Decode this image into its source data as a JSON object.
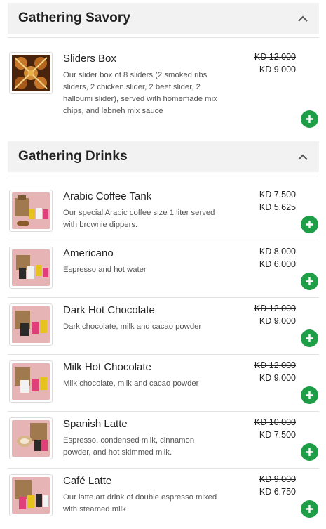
{
  "sections": [
    {
      "title": "Gathering Savory",
      "items": [
        {
          "name": "Sliders Box",
          "description": "Our slider box of 8 sliders (2 smoked ribs sliders, 2 chicken slider, 2 beef slider, 2 halloumi slider), served with homemade mix chips, and labneh mix sauce",
          "old_price": "KD 12.000",
          "price": "KD 9.000"
        }
      ]
    },
    {
      "title": "Gathering Drinks",
      "items": [
        {
          "name": "Arabic Coffee Tank",
          "description": "Our special Arabic coffee size 1 liter served with brownie dippers.",
          "old_price": "KD 7.500",
          "price": "KD 5.625"
        },
        {
          "name": "Americano",
          "description": "Espresso and hot water",
          "old_price": "KD 8.000",
          "price": "KD 6.000"
        },
        {
          "name": "Dark Hot Chocolate",
          "description": "Dark chocolate, milk and cacao powder",
          "old_price": "KD 12.000",
          "price": "KD 9.000"
        },
        {
          "name": "Milk Hot Chocolate",
          "description": "Milk chocolate, milk and cacao powder",
          "old_price": "KD 12.000",
          "price": "KD 9.000"
        },
        {
          "name": "Spanish Latte",
          "description": "Espresso, condensed milk, cinnamon powder, and hot skimmed milk.",
          "old_price": "KD 10.000",
          "price": "KD 7.500"
        },
        {
          "name": "Café Latte",
          "description": "Our latte art drink of double espresso mixed with steamed milk",
          "old_price": "KD 9.000",
          "price": "KD 6.750"
        }
      ]
    }
  ],
  "colors": {
    "add_button": "#1e9e47",
    "header_bg": "#f2f2f2",
    "drink_photo_bg": "#e7b4b6",
    "food_photo_bg": "#5a2e12"
  },
  "icons": {
    "collapse": "chevron-up-icon",
    "add": "plus-icon"
  }
}
